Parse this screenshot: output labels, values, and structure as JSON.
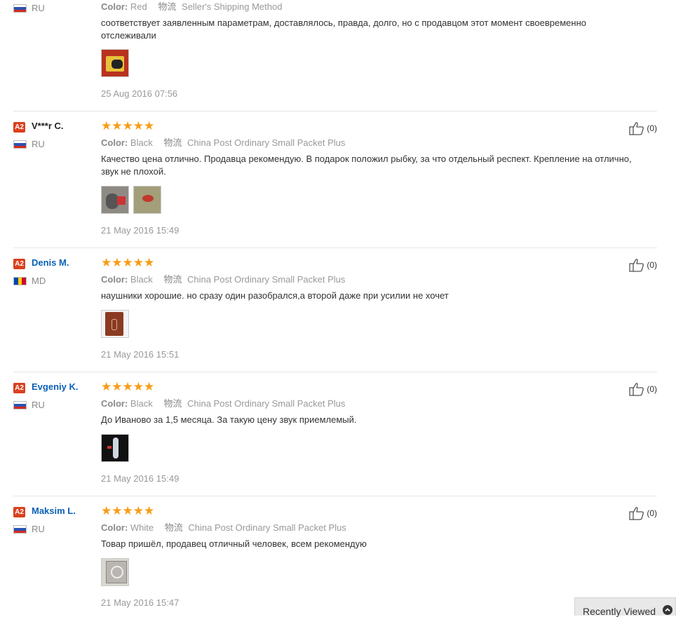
{
  "reviews": [
    {
      "country": "RU",
      "color_label": "Color:",
      "color": "Red",
      "logistics_label": "物流",
      "logistics": "Seller's Shipping Method",
      "text": "соответствует заявленным параметрам, доставлялось, правда, долго, но с продавцом этот момент своевременно отслеживали",
      "date": "25 Aug 2016 07:56"
    },
    {
      "level": "A2",
      "name": "V***r C.",
      "country": "RU",
      "stars": "★★★★★",
      "rating": 5,
      "color_label": "Color:",
      "color": "Black",
      "logistics_label": "物流",
      "logistics": "China Post Ordinary Small Packet Plus",
      "text": "Качество цена отлично. Продавца рекомендую. В подарок положил рыбку, за что отдельный респект. Крепление на отлично, звук не плохой.",
      "date": "21 May 2016 15:49",
      "likes": "(0)"
    },
    {
      "level": "A2",
      "name": "Denis M.",
      "country": "MD",
      "stars": "★★★★★",
      "rating": 5,
      "color_label": "Color:",
      "color": "Black",
      "logistics_label": "物流",
      "logistics": "China Post Ordinary Small Packet Plus",
      "text": "наушники хорошие. но сразу один разобрался,а второй даже при усилии не хочет",
      "date": "21 May 2016 15:51",
      "likes": "(0)"
    },
    {
      "level": "A2",
      "name": "Evgeniy K.",
      "country": "RU",
      "stars": "★★★★★",
      "rating": 5,
      "color_label": "Color:",
      "color": "Black",
      "logistics_label": "物流",
      "logistics": "China Post Ordinary Small Packet Plus",
      "text": "До Иваново за 1,5 месяца. За такую цену звук приемлемый.",
      "date": "21 May 2016 15:49",
      "likes": "(0)"
    },
    {
      "level": "A2",
      "name": "Maksim L.",
      "country": "RU",
      "stars": "★★★★★",
      "rating": 5,
      "color_label": "Color:",
      "color": "White",
      "logistics_label": "物流",
      "logistics": "China Post Ordinary Small Packet Plus",
      "text": "Товар пришёл, продавец отличный человек, всем рекомендую",
      "date": "21 May 2016 15:47",
      "likes": "(0)"
    }
  ],
  "recently_viewed": "Recently Viewed",
  "colors": {
    "accent_blue": "#0a61b6",
    "star": "#f89c14",
    "level_badge": "#d9411e"
  },
  "icons": {
    "like": "thumbs-up-icon",
    "collapse": "chevron-up-icon"
  }
}
